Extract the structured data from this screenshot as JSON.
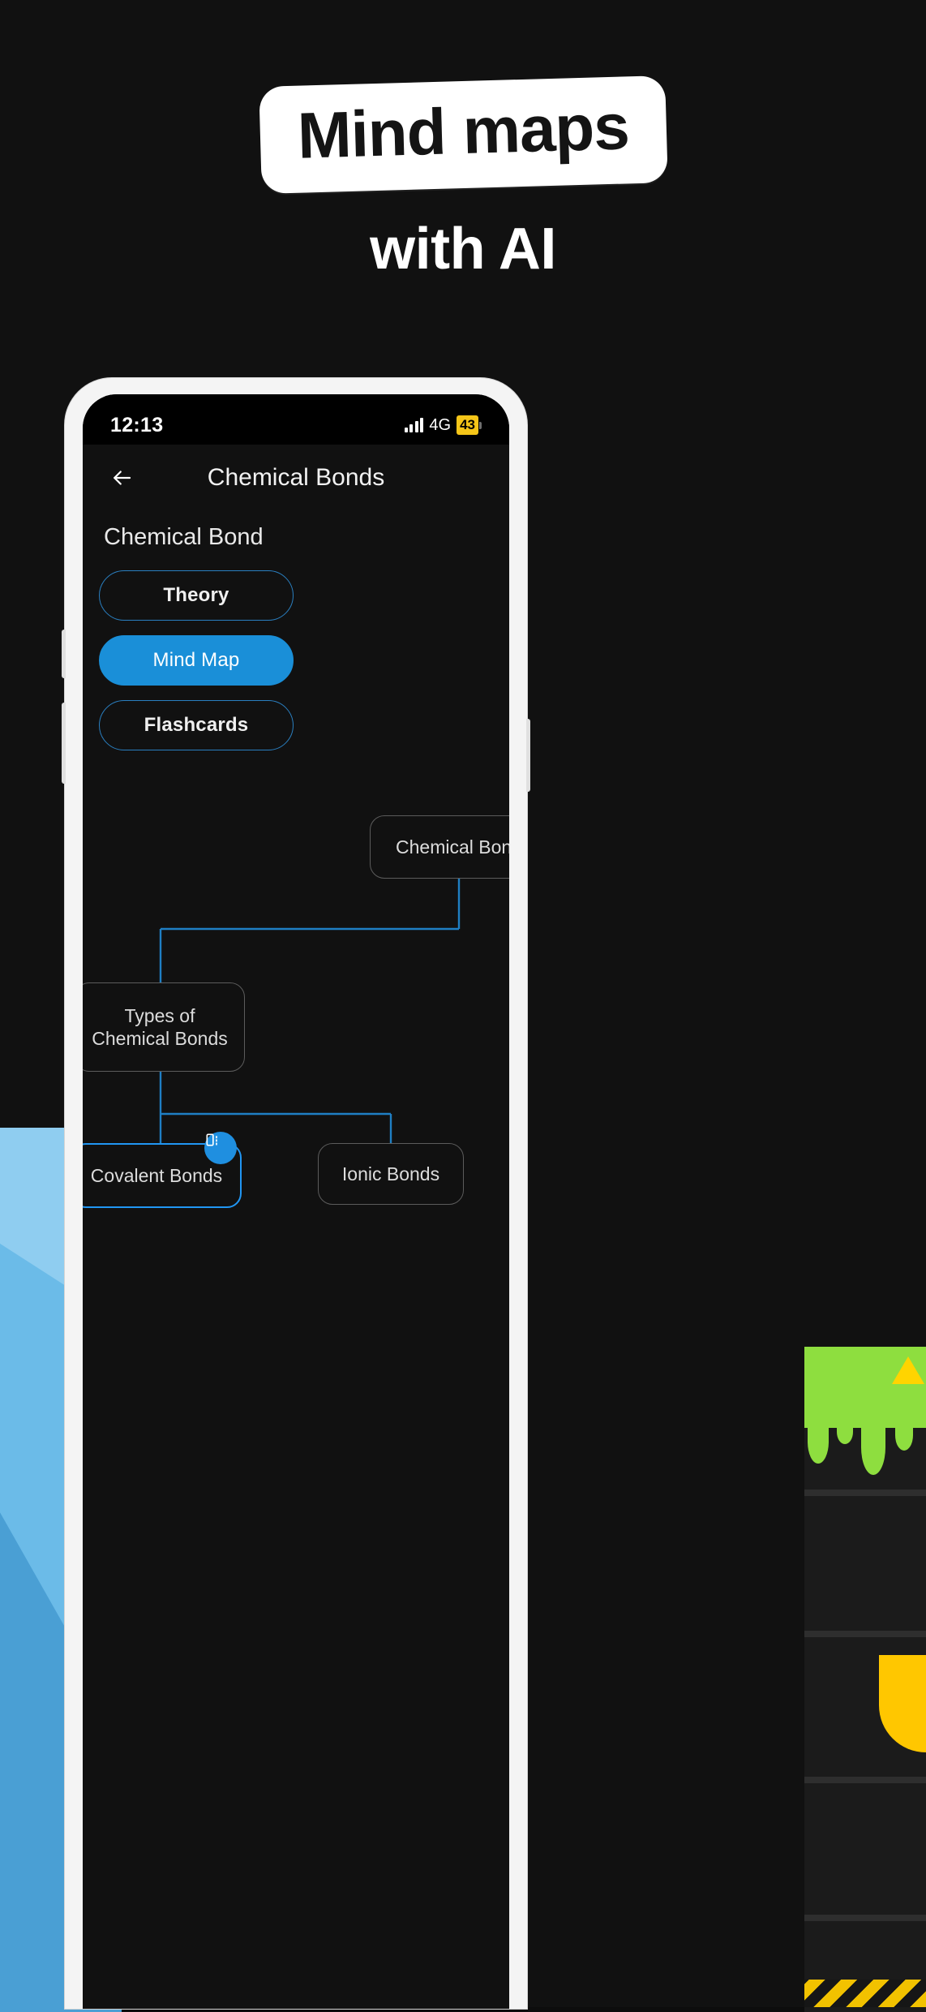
{
  "headline": {
    "badge_text": "Mind maps",
    "subtitle": "with AI"
  },
  "colors": {
    "background": "#111111",
    "accent_blue": "#1a8fd8",
    "outline_blue": "#2a7fc0",
    "node_border": "#5c5c5c",
    "active_node_border": "#2196f3",
    "badge_white": "#ffffff",
    "battery_yellow": "#f5c518",
    "decor_light_blue": "#6bbbe8",
    "decor_green": "#8ede3f",
    "decor_yellow": "#ffc700"
  },
  "phone": {
    "status_bar": {
      "time": "12:13",
      "network": "4G",
      "battery": "43",
      "signal_icon": "signal-bars-icon",
      "battery_icon": "battery-icon"
    },
    "app_header": {
      "back_icon": "back-arrow-icon",
      "title": "Chemical Bonds"
    },
    "subject_heading": "Chemical Bond",
    "tabs": [
      {
        "label": "Theory",
        "state": "outline"
      },
      {
        "label": "Mind Map",
        "state": "selected"
      },
      {
        "label": "Flashcards",
        "state": "outline"
      }
    ],
    "mindmap": {
      "badge_icon": "node-collapse-icon",
      "nodes": [
        {
          "id": "root",
          "label": "Chemical Bond",
          "state": "plain"
        },
        {
          "id": "types",
          "label": "Types of Chemical Bonds",
          "state": "plain"
        },
        {
          "id": "covalent",
          "label": "Covalent Bonds",
          "state": "active"
        },
        {
          "id": "ionic",
          "label": "Ionic Bonds",
          "state": "plain"
        }
      ]
    }
  }
}
